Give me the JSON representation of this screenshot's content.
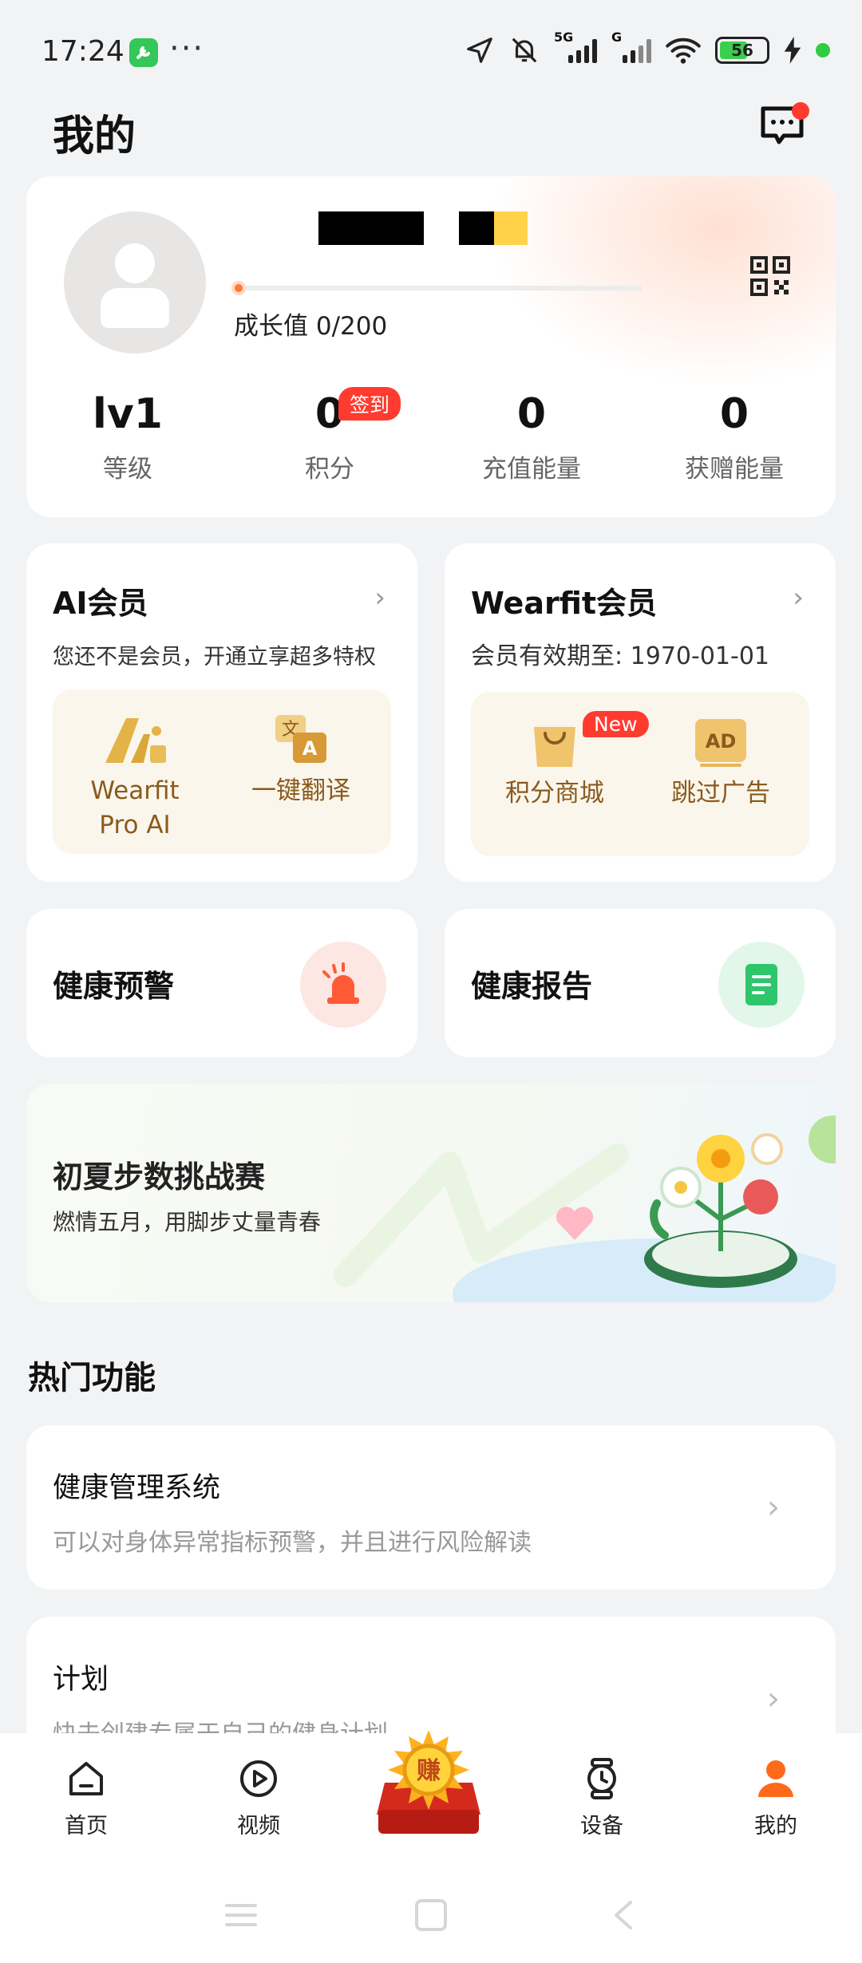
{
  "status_bar": {
    "time": "17:24",
    "more": "···",
    "net1": "5G",
    "net2": "G",
    "battery": "56",
    "icons": [
      "app-icon",
      "location-arrow-icon",
      "bell-muted-icon",
      "signal-icon",
      "wifi-icon",
      "battery-icon",
      "charging-icon"
    ]
  },
  "header": {
    "title": "我的",
    "message_icon": "chat-message-icon"
  },
  "profile": {
    "growth_label": "成长值 0/200",
    "growth_progress": 0.0,
    "stats": [
      {
        "value": "lv1",
        "label": "等级"
      },
      {
        "value": "0",
        "label": "积分"
      },
      {
        "value": "0",
        "label": "充值能量"
      },
      {
        "value": "0",
        "label": "获赠能量"
      }
    ],
    "signin_badge": "签到"
  },
  "ai_member": {
    "title": "AI会员",
    "subtitle": "您还不是会员，开通立享超多特权",
    "items": [
      {
        "label": "Wearfit\nPro AI",
        "icon": "wearfit-ai-logo-icon"
      },
      {
        "label": "一键翻译",
        "icon": "translate-icon"
      }
    ]
  },
  "wearfit_member": {
    "title": "Wearfit会员",
    "subtitle": "会员有效期至: 1970-01-01",
    "items": [
      {
        "label": "积分商城",
        "icon": "shopping-bag-icon",
        "badge": "New"
      },
      {
        "label": "跳过广告",
        "icon": "ad-icon",
        "icon_text": "AD"
      }
    ]
  },
  "health_warning": {
    "title": "健康预警",
    "icon": "alarm-light-icon",
    "color": "#ff5a36"
  },
  "health_report": {
    "title": "健康报告",
    "icon": "report-doc-icon",
    "color": "#2fc66b"
  },
  "challenge": {
    "title": "初夏步数挑战赛",
    "subtitle": "燃情五月，用脚步丈量青春"
  },
  "hot_functions": {
    "title": "热门功能",
    "items": [
      {
        "title": "健康管理系统",
        "desc": "可以对身体异常指标预警，并且进行风险解读"
      },
      {
        "title": "计划",
        "desc": "快去创建专属于自己的健身计划"
      }
    ]
  },
  "bottom_nav": {
    "items": [
      {
        "label": "首页",
        "icon": "home-icon"
      },
      {
        "label": "视频",
        "icon": "play-circle-icon"
      },
      {
        "label": "",
        "icon": "earn-coin-icon",
        "icon_text": "赚"
      },
      {
        "label": "设备",
        "icon": "watch-icon"
      },
      {
        "label": "我的",
        "icon": "person-icon",
        "active": true
      }
    ],
    "accent": "#ff6a1a"
  }
}
